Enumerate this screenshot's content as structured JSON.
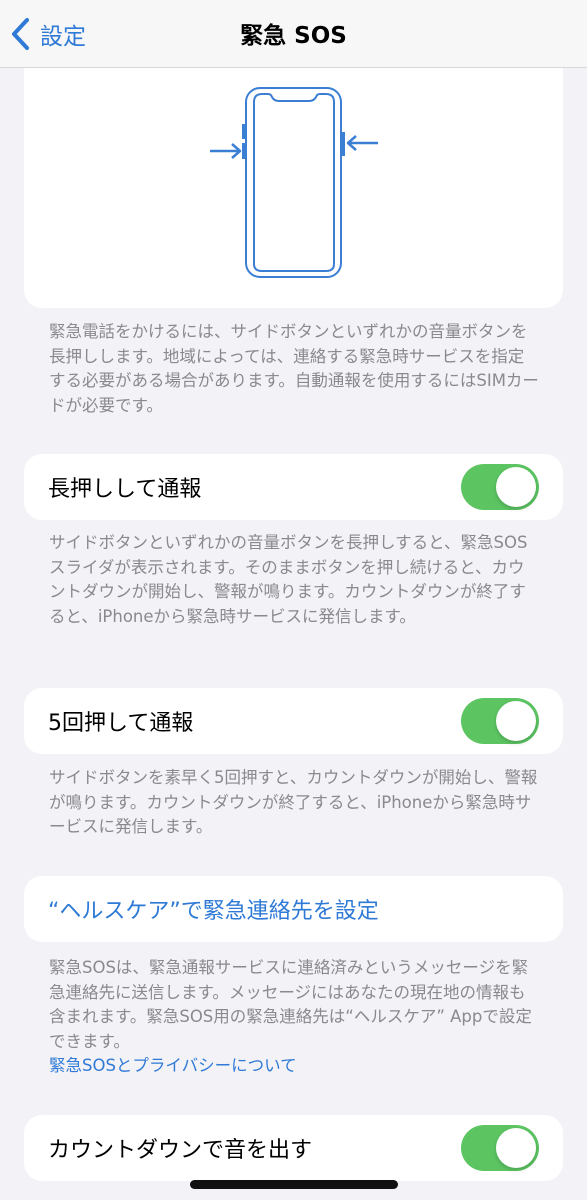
{
  "nav": {
    "back_label": "設定",
    "title": "緊急 SOS"
  },
  "illustration": {
    "icon": "iphone-side-buttons-illustration",
    "accent_color": "#3b7fd4"
  },
  "intro_footer": "緊急電話をかけるには、サイドボタンといずれかの音量ボタンを長押しします。地域によっては、連絡する緊急時サービスを指定する必要がある場合があります。自動通報を使用するにはSIMカードが必要です。",
  "hold": {
    "label": "長押しして通報",
    "on": true,
    "footer": "サイドボタンといずれかの音量ボタンを長押しすると、緊急SOSスライダが表示されます。そのままボタンを押し続けると、カウントダウンが開始し、警報が鳴ります。カウントダウンが終了すると、iPhoneから緊急時サービスに発信します。"
  },
  "five": {
    "label": "5回押して通報",
    "on": true,
    "footer": "サイドボタンを素早く5回押すと、カウントダウンが開始し、警報が鳴ります。カウントダウンが終了すると、iPhoneから緊急時サービスに発信します。"
  },
  "health": {
    "link_label": "“ヘルスケア”で緊急連絡先を設定",
    "footer": "緊急SOSは、緊急通報サービスに連絡済みというメッセージを緊急連絡先に送信します。メッセージにはあなたの現在地の情報も含まれます。緊急SOS用の緊急連絡先は“ヘルスケア” Appで設定できます。",
    "privacy_link": "緊急SOSとプライバシーについて"
  },
  "countdown": {
    "label": "カウントダウンで音を出す",
    "on": true
  },
  "colors": {
    "toggle_on": "#5cc562",
    "link": "#2f7ad6",
    "background": "#f2f2f7"
  }
}
